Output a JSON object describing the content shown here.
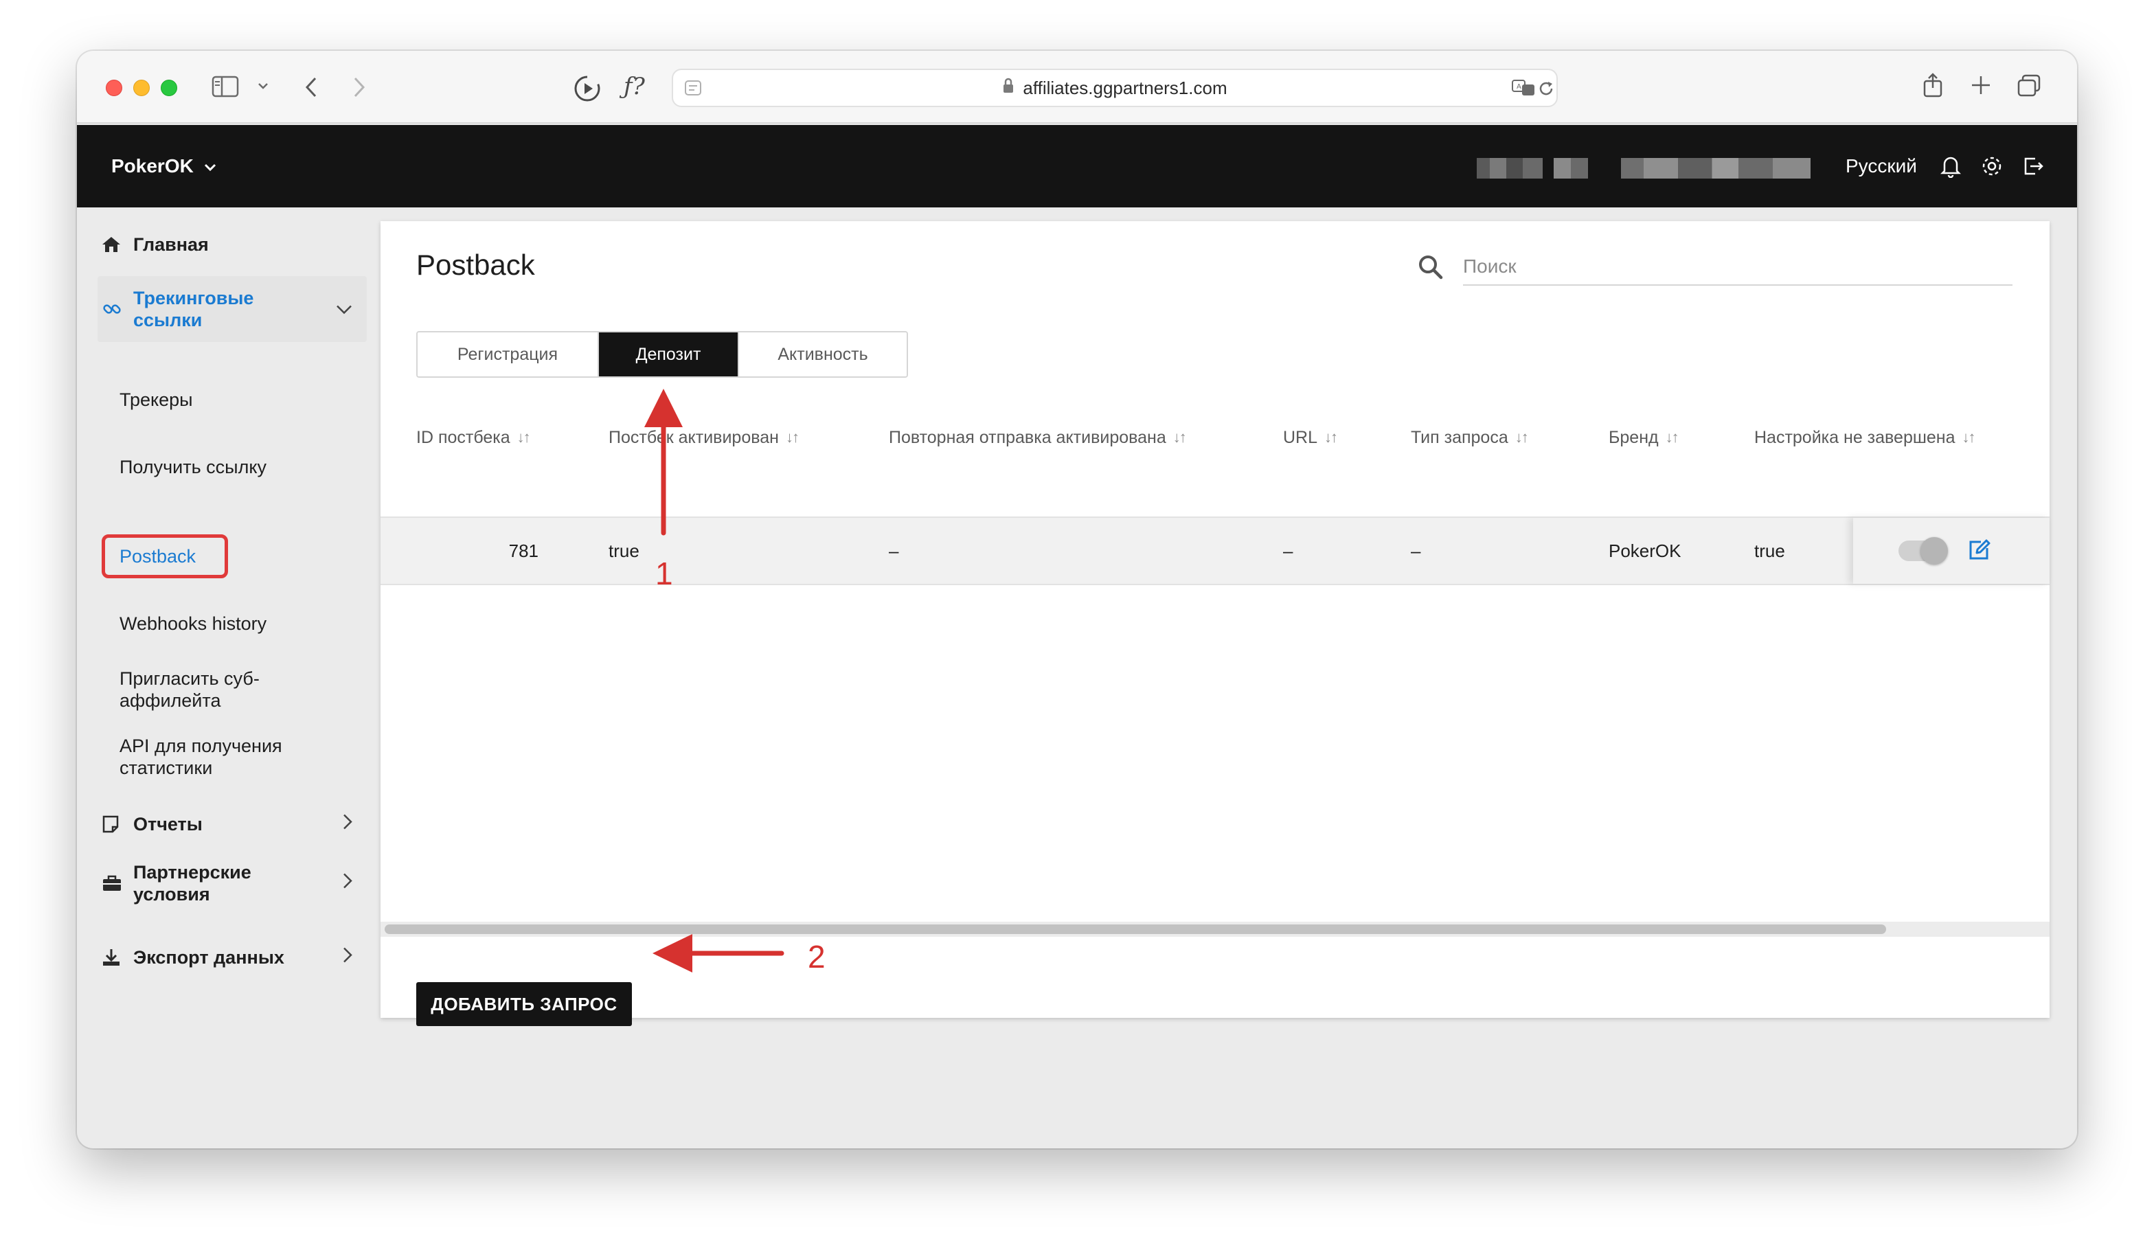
{
  "browser": {
    "url": "affiliates.ggpartners1.com"
  },
  "header": {
    "brand": "PokerOK",
    "language": "Русский"
  },
  "sidebar": {
    "items": [
      {
        "label": "Главная"
      },
      {
        "label": "Трекинговые ссылки"
      },
      {
        "label": "Отчеты"
      },
      {
        "label": "Партнерские условия"
      },
      {
        "label": "Экспорт данных"
      }
    ],
    "subitems": [
      {
        "label": "Трекеры"
      },
      {
        "label": "Получить ссылку"
      },
      {
        "label": "Postback"
      },
      {
        "label": "Webhooks history"
      },
      {
        "label": "Пригласить суб-аффилейта"
      },
      {
        "label": "API для получения статистики"
      }
    ]
  },
  "main": {
    "title": "Postback",
    "search_placeholder": "Поиск",
    "tabs": [
      {
        "label": "Регистрация"
      },
      {
        "label": "Депозит"
      },
      {
        "label": "Активность"
      }
    ],
    "active_tab": "Депозит",
    "columns": [
      "ID постбека",
      "Постбек активирован",
      "Повторная отправка активирована",
      "URL",
      "Тип запроса",
      "Бренд",
      "Настройка не завершена"
    ],
    "rows": [
      {
        "id": "781",
        "activated": "true",
        "resend": "–",
        "url": "–",
        "request_type": "–",
        "brand": "PokerOK",
        "incomplete": "true",
        "toggle_on": false
      }
    ],
    "add_button": "ДОБАВИТЬ ЗАПРОС"
  },
  "annotations": {
    "marker_1": "1",
    "marker_2": "2",
    "color": "#d6322f"
  },
  "colors": {
    "accent": "#1b7bd1",
    "header_bg": "#141414",
    "annotation_red": "#e03a3a"
  }
}
